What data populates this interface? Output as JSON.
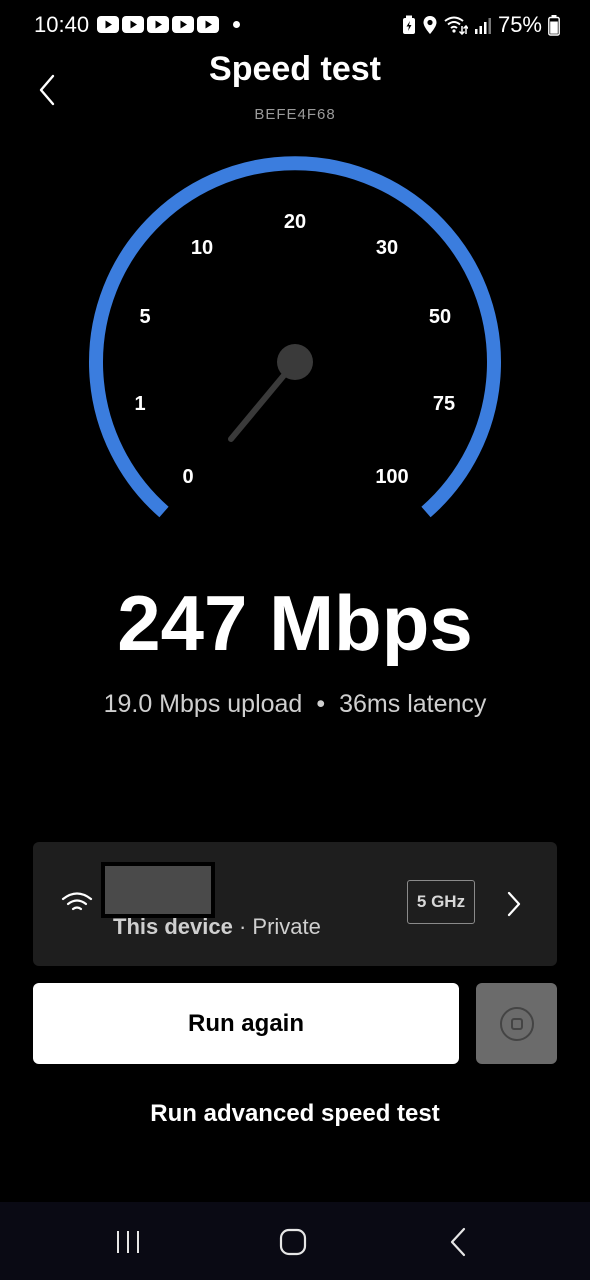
{
  "status_bar": {
    "time": "10:40",
    "battery_percent": "75%",
    "notification_icons": [
      "youtube-icon",
      "youtube-icon",
      "youtube-icon",
      "youtube-icon",
      "youtube-icon"
    ]
  },
  "header": {
    "title": "Speed test",
    "device_id": "BEFE4F68"
  },
  "gauge": {
    "tick_labels": [
      "0",
      "1",
      "5",
      "10",
      "20",
      "30",
      "50",
      "75",
      "100"
    ],
    "arc_color": "#3b7dde"
  },
  "result": {
    "download": "247 Mbps",
    "upload": "19.0 Mbps upload",
    "separator": "•",
    "latency": "36ms latency"
  },
  "network": {
    "device_label": "This device",
    "separator": " · ",
    "privacy": "Private",
    "band": "5 GHz"
  },
  "actions": {
    "run_again": "Run again",
    "advanced": "Run advanced speed test"
  }
}
